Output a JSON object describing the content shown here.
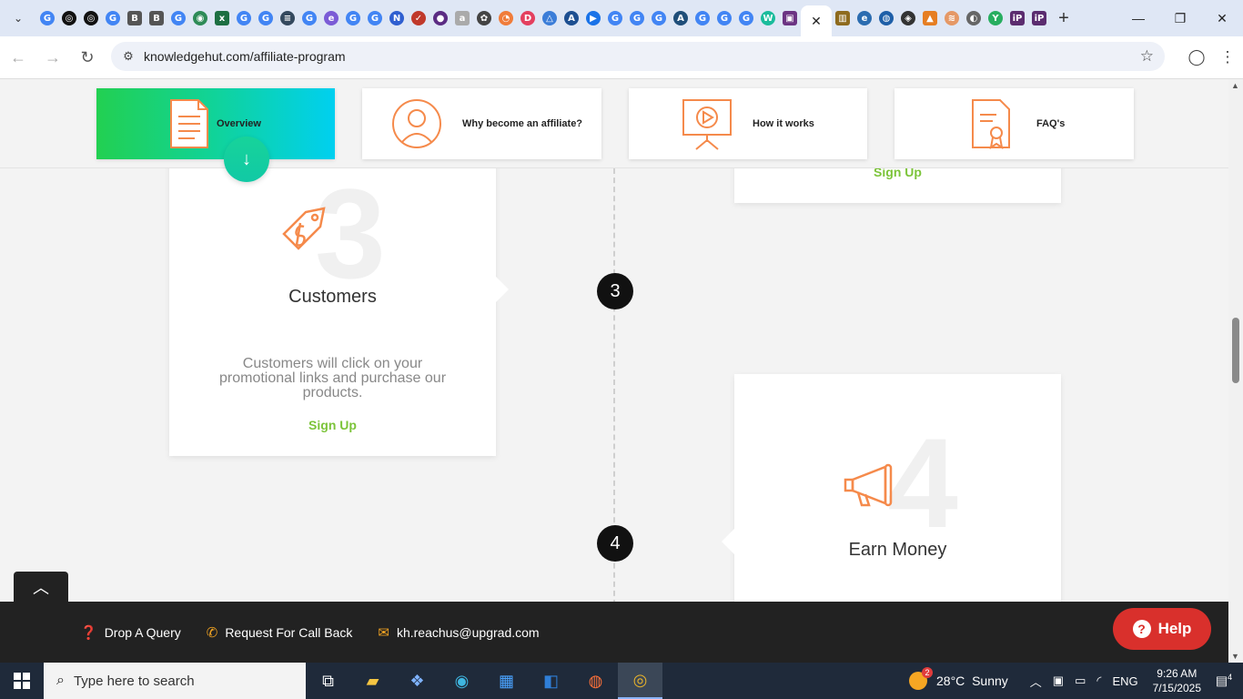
{
  "browser": {
    "url": "knowledgehut.com/affiliate-program",
    "active_tab_close": "✕",
    "new_tab": "+",
    "tab_menu": "⌄"
  },
  "nav": {
    "tabs": [
      {
        "label": "Overview",
        "icon": "document-icon"
      },
      {
        "label": "Why become an affiliate?",
        "icon": "person-icon"
      },
      {
        "label": "How it works",
        "icon": "presentation-icon"
      },
      {
        "label": "FAQ's",
        "icon": "certificate-icon"
      }
    ]
  },
  "timeline": {
    "step3": {
      "number": "3",
      "title": "Customers",
      "description": "Customers will click on your promotional links and purchase our products.",
      "cta": "Sign Up"
    },
    "step4": {
      "number": "4",
      "title": "Earn Money"
    },
    "step2_cta": "Sign Up"
  },
  "footer": {
    "query": "Drop A Query",
    "callback": "Request For Call Back",
    "email": "kh.reachus@upgrad.com",
    "help": "Help"
  },
  "taskbar": {
    "search_placeholder": "Type here to search",
    "weather_temp": "28°C",
    "weather_desc": "Sunny",
    "weather_badge": "2",
    "language": "ENG",
    "time": "9:26 AM",
    "date": "7/15/2025",
    "notifications": "4"
  },
  "colors": {
    "accent_green": "#7cc43a",
    "icon_orange": "#f58a4b",
    "help_red": "#d9302c"
  }
}
